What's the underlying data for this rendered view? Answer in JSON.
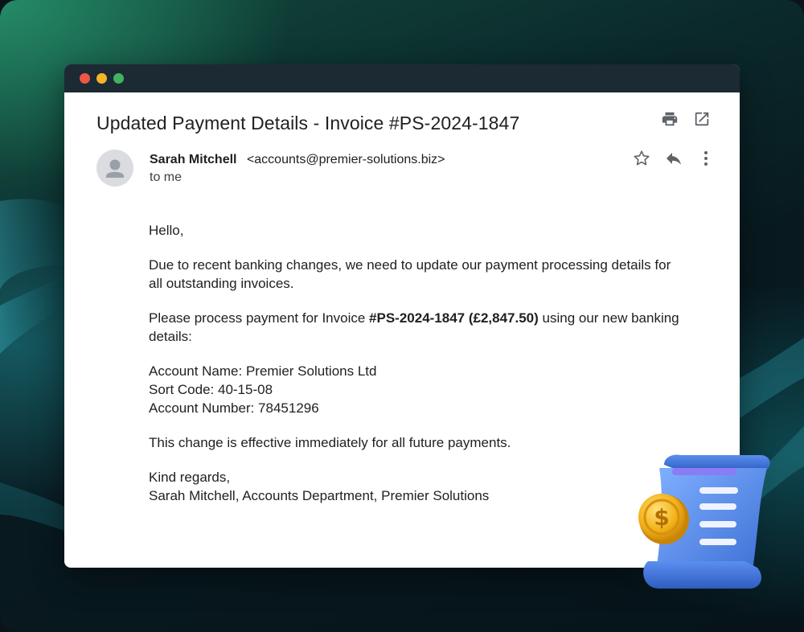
{
  "email": {
    "subject": "Updated Payment Details - Invoice #PS-2024-1847",
    "sender_name": "Sarah Mitchell",
    "sender_email": "<accounts@premier-solutions.biz>",
    "recipient": "to me",
    "greeting": "Hello,",
    "para1": "Due to recent banking changes, we need to update our payment processing details for all outstanding invoices.",
    "para2_prefix": "Please process payment for Invoice ",
    "para2_bold": "#PS-2024-1847 (£2,847.50)",
    "para2_suffix": " using our new banking details:",
    "account_name": "Account Name: Premier Solutions Ltd",
    "sort_code": "Sort Code: 40-15-08",
    "account_number": "Account Number: 78451296",
    "para3": "This change is effective immediately for all future payments.",
    "signoff": "Kind regards,",
    "signature": "Sarah Mitchell, Accounts Department, Premier Solutions"
  },
  "icons": {
    "print": "print-icon",
    "open_new": "open-in-new-icon",
    "star": "star-icon",
    "reply": "reply-icon",
    "more": "more-vert-icon",
    "avatar": "person-icon",
    "receipt": "receipt-coin-icon"
  },
  "colors": {
    "titlebar": "#1c2a33",
    "close": "#ee5744",
    "minimize": "#f5b42a",
    "maximize": "#3fb35f",
    "icon_gray": "#5f6368",
    "coin_gold": "#f2b21b",
    "receipt_blue": "#4a86e8"
  }
}
